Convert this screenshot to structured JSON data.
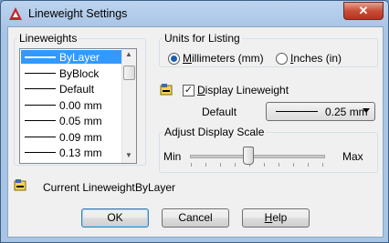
{
  "window": {
    "title": "Lineweight Settings",
    "close_label": "✕"
  },
  "lineweights": {
    "legend": "Lineweights",
    "items": [
      {
        "label": "ByLayer",
        "selected": true
      },
      {
        "label": "ByBlock",
        "selected": false
      },
      {
        "label": "Default",
        "selected": false
      },
      {
        "label": "0.00 mm",
        "selected": false
      },
      {
        "label": "0.05 mm",
        "selected": false
      },
      {
        "label": "0.09 mm",
        "selected": false
      },
      {
        "label": "0.13 mm",
        "selected": false
      }
    ]
  },
  "units": {
    "legend": "Units for Listing",
    "millimeters_label": "Millimeters (mm)",
    "millimeters_selected": true,
    "inches_label": "Inches (in)",
    "inches_selected": false
  },
  "display": {
    "display_lineweight_label": "Display Lineweight",
    "display_lineweight_checked": true,
    "default_label": "Default",
    "default_value": "0.25 mm"
  },
  "scale": {
    "legend": "Adjust Display Scale",
    "min_label": "Min",
    "max_label": "Max",
    "position_fraction": 0.43
  },
  "current": {
    "label": "Current Lineweight:",
    "value": "ByLayer"
  },
  "buttons": {
    "ok": "OK",
    "cancel": "Cancel",
    "help": "Help"
  },
  "colors": {
    "selection": "#3399ff",
    "accent": "#1c5fb0"
  }
}
